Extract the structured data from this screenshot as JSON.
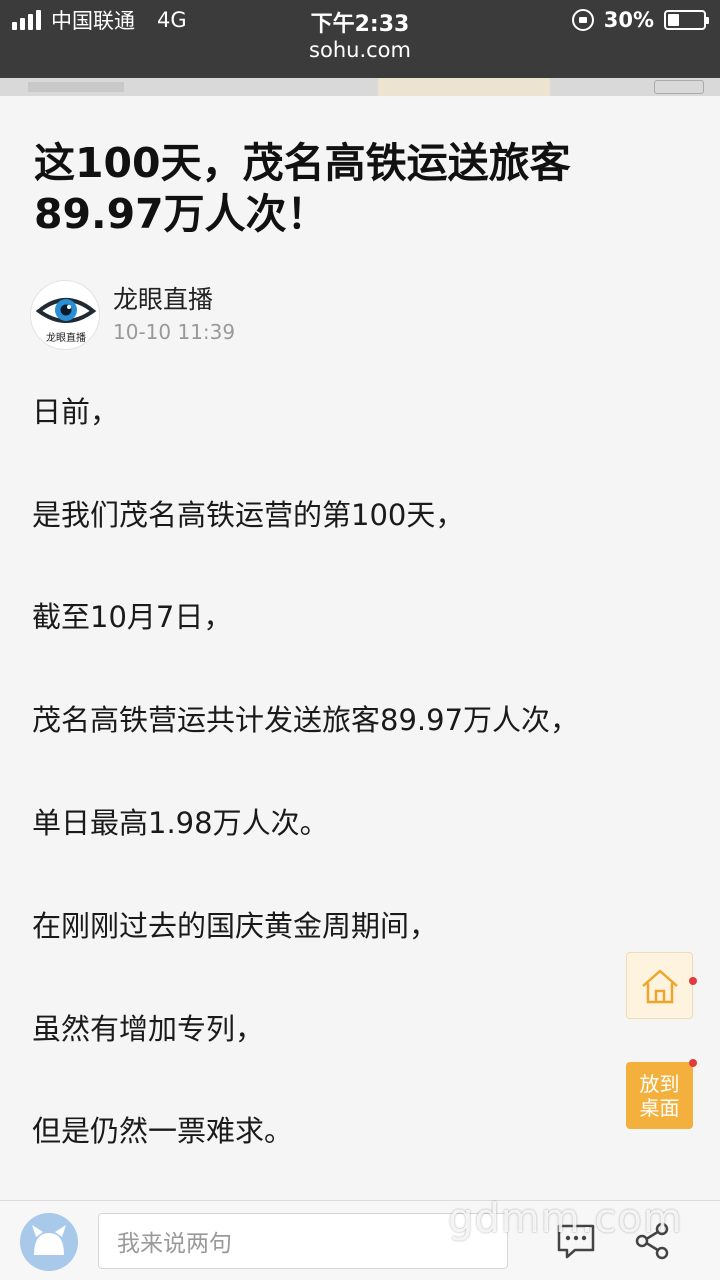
{
  "status_bar": {
    "carrier": "中国联通",
    "network": "4G",
    "time": "下午2:33",
    "battery": "30%"
  },
  "browser": {
    "url": "sohu.com"
  },
  "article": {
    "title_line1": "这100天，茂名高铁运送旅客",
    "title_line2": "89.97万人次！",
    "author": {
      "name": "龙眼直播",
      "avatar_text": "龙眼直播",
      "time": "10-10 11:39"
    },
    "paragraphs": [
      "日前，",
      "是我们茂名高铁运营的第100天，",
      "截至10月7日，",
      "茂名高铁营运共计发送旅客89.97万人次，",
      "单日最高1.98万人次。",
      "在刚刚过去的国庆黄金周期间，",
      "虽然有增加专列，",
      "但是仍然一票难求。"
    ]
  },
  "floating": {
    "home_icon": "home-icon",
    "desk_line1": "放到",
    "desk_line2": "桌面"
  },
  "bottom_bar": {
    "comment_placeholder": "我来说两句",
    "comment_icon": "comment-icon",
    "share_icon": "share-icon"
  },
  "watermark": "gdmm.com",
  "colors": {
    "accent": "#f3b03c",
    "notification_dot": "#e23b3b",
    "status_bar": "#3b3b3b"
  }
}
